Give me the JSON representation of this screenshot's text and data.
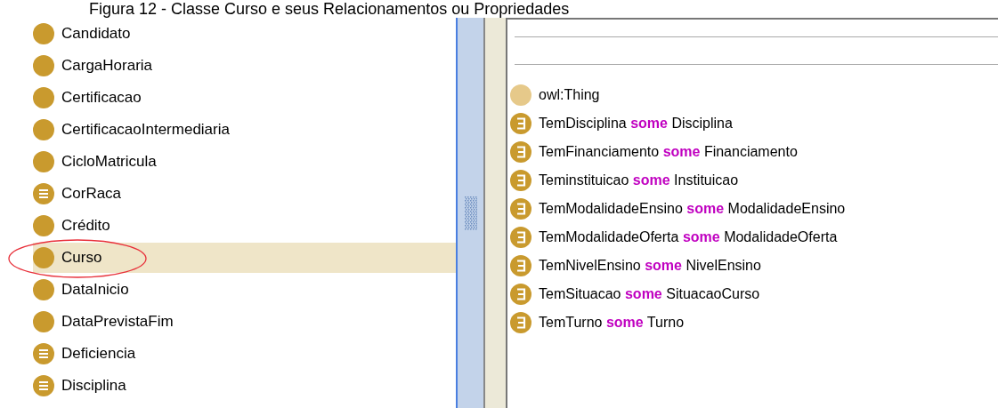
{
  "caption": "Figura 12 - Classe Curso e seus Relacionamentos ou Propriedades",
  "class_tree": [
    {
      "label": "Candidato",
      "kind": "primitive",
      "selected": false,
      "circled": false
    },
    {
      "label": "CargaHoraria",
      "kind": "primitive",
      "selected": false,
      "circled": false
    },
    {
      "label": "Certificacao",
      "kind": "primitive",
      "selected": false,
      "circled": false
    },
    {
      "label": "CertificacaoIntermediaria",
      "kind": "primitive",
      "selected": false,
      "circled": false
    },
    {
      "label": "CicloMatricula",
      "kind": "primitive",
      "selected": false,
      "circled": false
    },
    {
      "label": "CorRaca",
      "kind": "defined",
      "selected": false,
      "circled": false
    },
    {
      "label": "Crédito",
      "kind": "primitive",
      "selected": false,
      "circled": false
    },
    {
      "label": "Curso",
      "kind": "primitive",
      "selected": true,
      "circled": true
    },
    {
      "label": "DataInicio",
      "kind": "primitive",
      "selected": false,
      "circled": false
    },
    {
      "label": "DataPrevistaFim",
      "kind": "primitive",
      "selected": false,
      "circled": false
    },
    {
      "label": "Deficiencia",
      "kind": "defined",
      "selected": false,
      "circled": false
    },
    {
      "label": "Disciplina",
      "kind": "defined",
      "selected": false,
      "circled": false
    }
  ],
  "superclasses": [
    {
      "kind": "thing",
      "label": "owl:Thing"
    },
    {
      "kind": "restriction",
      "property": "TemDisciplina",
      "keyword": "some",
      "filler": "Disciplina"
    },
    {
      "kind": "restriction",
      "property": "TemFinanciamento",
      "keyword": "some",
      "filler": "Financiamento"
    },
    {
      "kind": "restriction",
      "property": "Teminstituicao",
      "keyword": "some",
      "filler": "Instituicao"
    },
    {
      "kind": "restriction",
      "property": "TemModalidadeEnsino",
      "keyword": "some",
      "filler": "ModalidadeEnsino"
    },
    {
      "kind": "restriction",
      "property": "TemModalidadeOferta",
      "keyword": "some",
      "filler": "ModalidadeOferta"
    },
    {
      "kind": "restriction",
      "property": "TemNivelEnsino",
      "keyword": "some",
      "filler": "NivelEnsino"
    },
    {
      "kind": "restriction",
      "property": "TemSituacao",
      "keyword": "some",
      "filler": "SituacaoCurso"
    },
    {
      "kind": "restriction",
      "property": "TemTurno",
      "keyword": "some",
      "filler": "Turno"
    }
  ]
}
